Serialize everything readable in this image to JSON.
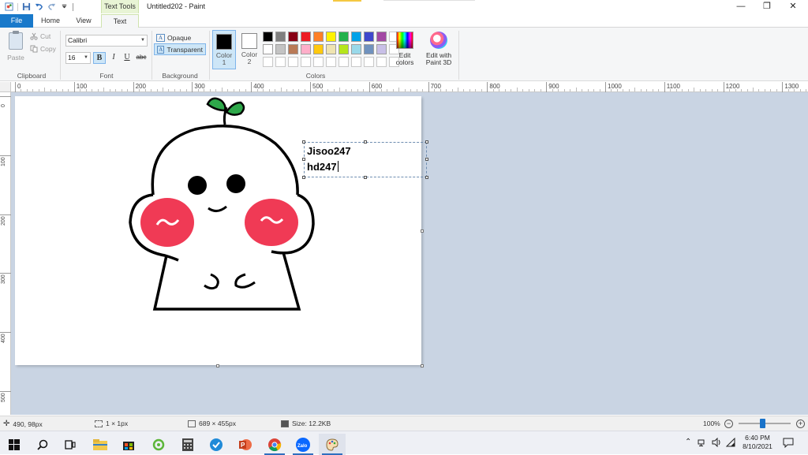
{
  "titlebar": {
    "context_tab": "Text Tools",
    "window_title": "Untitled202 - Paint",
    "minimize": "—",
    "maximize": "❐",
    "close": "✕"
  },
  "tabs": {
    "file": "File",
    "home": "Home",
    "view": "View",
    "text": "Text"
  },
  "clipboard": {
    "paste": "Paste",
    "cut": "Cut",
    "copy": "Copy",
    "group": "Clipboard"
  },
  "font": {
    "family": "Calibri",
    "size": "16",
    "bold": "B",
    "italic": "I",
    "underline": "U",
    "strike": "abc",
    "group": "Font"
  },
  "background": {
    "opaque": "Opaque",
    "transparent": "Transparent",
    "group": "Background"
  },
  "colors": {
    "color1_label": "Color 1",
    "color2_label": "Color 2",
    "color1_value": "#000000",
    "color2_value": "#ffffff",
    "group": "Colors",
    "edit_colors": "Edit colors",
    "edit_paint3d": "Edit with Paint 3D",
    "palette_row1": [
      "#000000",
      "#7f7f7f",
      "#880015",
      "#ed1c24",
      "#ff7f27",
      "#fff200",
      "#22b14c",
      "#00a2e8",
      "#3f48cc",
      "#a349a4"
    ],
    "palette_row2": [
      "#ffffff",
      "#c3c3c3",
      "#b97a57",
      "#ffaec9",
      "#ffc90e",
      "#efe4b0",
      "#b5e61d",
      "#99d9ea",
      "#7092be",
      "#c8bfe7"
    ]
  },
  "ruler": {
    "h_labels": [
      "0",
      "100",
      "200",
      "300",
      "400",
      "500",
      "600",
      "700",
      "800",
      "900",
      "1000",
      "1100",
      "1200",
      "1300"
    ],
    "v_labels": [
      "0",
      "100",
      "200",
      "300",
      "400",
      "500"
    ]
  },
  "canvas": {
    "text_line1": "Jisoo247",
    "text_line2": "hd247"
  },
  "statusbar": {
    "cursor": "490, 98px",
    "selection": "1 × 1px",
    "canvas_size": "689 × 455px",
    "file_size": "Size: 12.2KB",
    "zoom": "100%",
    "zoom_minus": "−",
    "zoom_plus": "+"
  },
  "taskbar": {
    "time": "6:40 PM",
    "date": "8/10/2021",
    "zalo_label": "Zalo"
  }
}
